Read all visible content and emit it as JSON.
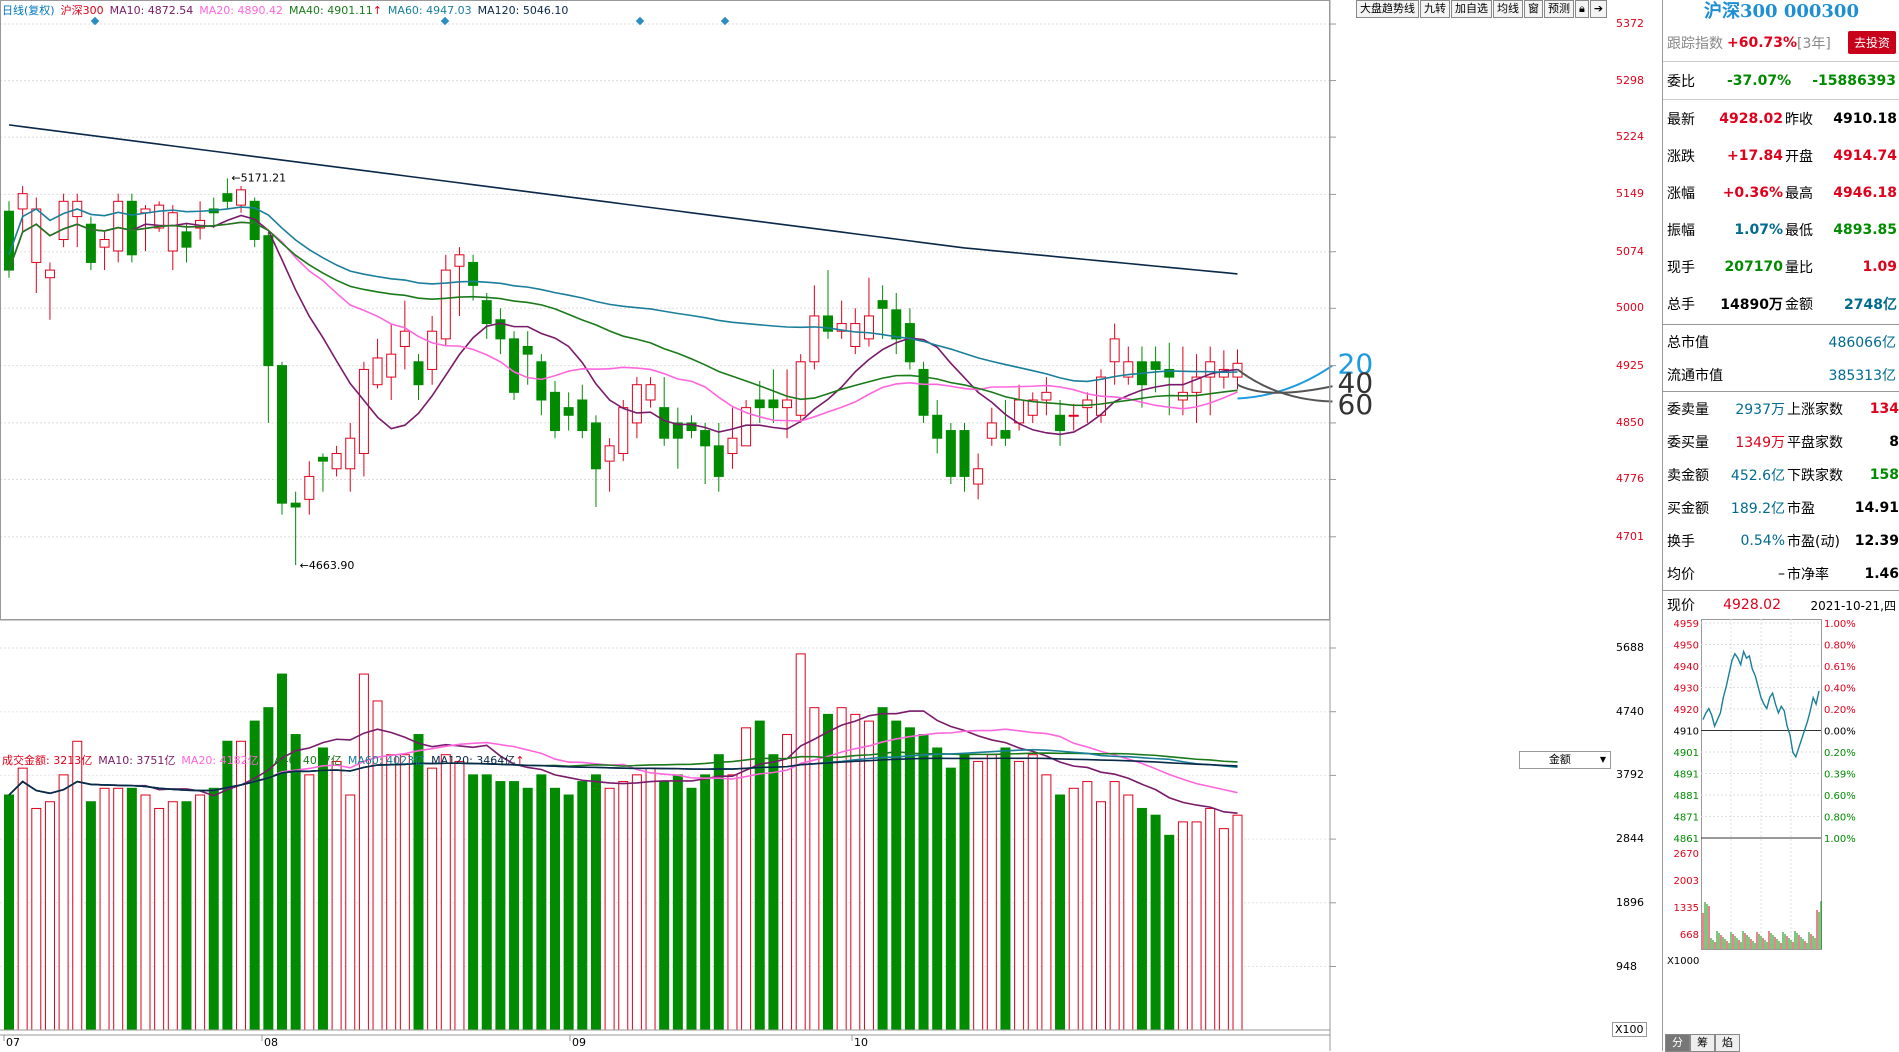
{
  "legend": {
    "period": "日线(复权)",
    "name": "沪深300",
    "ma10": "MA10: 4872.54",
    "ma20": "MA20: 4890.42",
    "ma40": "MA40: 4901.11",
    "ma60": "MA60: 4947.03",
    "ma120": "MA120: 5046.10"
  },
  "toolbar": {
    "trend": "大盘趋势线",
    "nine": "九转",
    "add_watch": "加自选",
    "avg_line": "均线",
    "window": "窗",
    "forecast": "预测",
    "lock_icon": "lock-icon",
    "exit_icon": "exit-icon"
  },
  "price_axis": [
    "5372",
    "5298",
    "5224",
    "5149",
    "5074",
    "5000",
    "4925",
    "4850",
    "4776",
    "4701"
  ],
  "date_axis": [
    "07",
    "08",
    "09",
    "10"
  ],
  "annotations": {
    "high": "5171.21",
    "low": "4663.90"
  },
  "ma_tags": [
    "20",
    "40",
    "60"
  ],
  "vol_legend": {
    "amount": "成交金额: 3213亿",
    "ma10": "MA10: 3751亿",
    "ma20": "MA20: 4182亿",
    "ma40": "MA40: 4077亿",
    "ma60": "MA60: 4023亿",
    "ma120": "MA120: 3464亿"
  },
  "amount_select": "金额",
  "vol_axis": [
    "5688",
    "4740",
    "3792",
    "2844",
    "1896",
    "948"
  ],
  "vol_unit": "X100",
  "side": {
    "title": "沪深300 000300",
    "track_label": "跟踪指数",
    "track_value": "+60.73%",
    "track_period": "[3年]",
    "invest_btn": "去投资",
    "wb_label": "委比",
    "wb_pct": "-37.07%",
    "wb_val": "-15886393",
    "quotes": [
      {
        "l1": "最新",
        "v1": "4928.02",
        "l2": "昨收",
        "v2": "4910.18"
      },
      {
        "l1": "涨跌",
        "v1": "+17.84",
        "l2": "开盘",
        "v2": "4914.74"
      },
      {
        "l1": "涨幅",
        "v1": "+0.36%",
        "l2": "最高",
        "v2": "4946.18"
      },
      {
        "l1": "振幅",
        "v1": "1.07%",
        "l2": "最低",
        "v2": "4893.85"
      },
      {
        "l1": "现手",
        "v1": "207170",
        "l2": "量比",
        "v2": "1.09"
      },
      {
        "l1": "总手",
        "v1": "14890万",
        "l2": "金额",
        "v2": "2748亿"
      }
    ],
    "mktcap_label": "总市值",
    "mktcap_val": "486066亿",
    "float_label": "流通市值",
    "float_val": "385313亿",
    "market": [
      {
        "l1": "委卖量",
        "v1": "2937万",
        "l2": "上涨家数",
        "v2": "134"
      },
      {
        "l1": "委买量",
        "v1": "1349万",
        "l2": "平盘家数",
        "v2": "8"
      },
      {
        "l1": "卖金额",
        "v1": "452.6亿",
        "l2": "下跌家数",
        "v2": "158"
      },
      {
        "l1": "买金额",
        "v1": "189.2亿",
        "l2": "市盈",
        "v2": "14.91"
      },
      {
        "l1": "换手",
        "v1": "0.54%",
        "l2": "市盈(动)",
        "v2": "12.39"
      },
      {
        "l1": "均价",
        "v1": "–",
        "l2": "市净率",
        "v2": "1.46"
      }
    ],
    "now_label": "现价",
    "now_val": "4928.02",
    "date": "2021-10-21,四",
    "mini_left": [
      "4959",
      "4950",
      "4940",
      "4930",
      "4920",
      "4910",
      "4901",
      "4891",
      "4881",
      "4871",
      "4861"
    ],
    "mini_right": [
      "1.00%",
      "0.80%",
      "0.61%",
      "0.40%",
      "0.20%",
      "0.00%",
      "0.20%",
      "0.39%",
      "0.60%",
      "0.80%",
      "1.00%"
    ],
    "mini_vol": [
      "2670",
      "2003",
      "1335",
      "668"
    ],
    "mini_unit": "X1000",
    "tabs": [
      "分",
      "筹",
      "焰"
    ]
  },
  "colors": {
    "up": "#e0001b",
    "down": "#008b00",
    "ma10": "#7a1a6a",
    "ma20": "#ff66dd",
    "ma40": "#1a7a1a",
    "ma60": "#1a7f9a",
    "ma120": "#0a2848",
    "tag20": "#1e9be0"
  },
  "chart_data": {
    "type": "candlestick",
    "ylim": [
      4663,
      5372
    ],
    "candles": [
      [
        5127,
        5050,
        5140,
        5040
      ],
      [
        5130,
        5150,
        5160,
        5100
      ],
      [
        5060,
        5130,
        5145,
        5020
      ],
      [
        5040,
        5050,
        5060,
        4985
      ],
      [
        5090,
        5140,
        5150,
        5080
      ],
      [
        5120,
        5140,
        5150,
        5080
      ],
      [
        5110,
        5060,
        5120,
        5050
      ],
      [
        5080,
        5090,
        5100,
        5050
      ],
      [
        5075,
        5140,
        5150,
        5060
      ],
      [
        5140,
        5070,
        5150,
        5060
      ],
      [
        5125,
        5130,
        5135,
        5075
      ],
      [
        5105,
        5135,
        5140,
        5100
      ],
      [
        5075,
        5125,
        5135,
        5050
      ],
      [
        5100,
        5080,
        5110,
        5060
      ],
      [
        5105,
        5115,
        5140,
        5090
      ],
      [
        5130,
        5125,
        5145,
        5105
      ],
      [
        5150,
        5140,
        5170,
        5130
      ],
      [
        5135,
        5155,
        5160,
        5125
      ],
      [
        5140,
        5090,
        5145,
        5080
      ],
      [
        5095,
        4925,
        5100,
        4850
      ],
      [
        4925,
        4745,
        4930,
        4730
      ],
      [
        4745,
        4740,
        4760,
        4664
      ],
      [
        4750,
        4780,
        4800,
        4730
      ],
      [
        4805,
        4800,
        4810,
        4760
      ],
      [
        4790,
        4810,
        4820,
        4780
      ],
      [
        4790,
        4830,
        4850,
        4760
      ],
      [
        4810,
        4920,
        4930,
        4780
      ],
      [
        4900,
        4935,
        4960,
        4895
      ],
      [
        4910,
        4940,
        4980,
        4880
      ],
      [
        4950,
        4970,
        5010,
        4920
      ],
      [
        4930,
        4900,
        4940,
        4880
      ],
      [
        4920,
        4970,
        4990,
        4900
      ],
      [
        4960,
        5050,
        5070,
        4950
      ],
      [
        5055,
        5070,
        5080,
        4990
      ],
      [
        5060,
        5030,
        5070,
        5010
      ],
      [
        5010,
        4980,
        5020,
        4960
      ],
      [
        4985,
        4960,
        5000,
        4940
      ],
      [
        4960,
        4890,
        4970,
        4880
      ],
      [
        4950,
        4940,
        4970,
        4900
      ],
      [
        4930,
        4880,
        4940,
        4860
      ],
      [
        4890,
        4840,
        4905,
        4830
      ],
      [
        4870,
        4860,
        4890,
        4840
      ],
      [
        4880,
        4840,
        4900,
        4830
      ],
      [
        4850,
        4790,
        4860,
        4740
      ],
      [
        4800,
        4820,
        4830,
        4760
      ],
      [
        4810,
        4870,
        4880,
        4800
      ],
      [
        4850,
        4900,
        4910,
        4830
      ],
      [
        4880,
        4900,
        4910,
        4870
      ],
      [
        4870,
        4830,
        4910,
        4820
      ],
      [
        4850,
        4830,
        4870,
        4790
      ],
      [
        4850,
        4840,
        4860,
        4830
      ],
      [
        4840,
        4820,
        4850,
        4770
      ],
      [
        4820,
        4780,
        4850,
        4760
      ],
      [
        4810,
        4830,
        4870,
        4790
      ],
      [
        4820,
        4870,
        4880,
        4820
      ],
      [
        4880,
        4870,
        4905,
        4850
      ],
      [
        4880,
        4870,
        4920,
        4850
      ],
      [
        4870,
        4880,
        4920,
        4830
      ],
      [
        4860,
        4930,
        4940,
        4850
      ],
      [
        4930,
        4990,
        5030,
        4920
      ],
      [
        4990,
        4970,
        5050,
        4960
      ],
      [
        4970,
        4980,
        5010,
        4960
      ],
      [
        4950,
        4980,
        5000,
        4940
      ],
      [
        4960,
        4990,
        5040,
        4950
      ],
      [
        5010,
        5000,
        5030,
        4960
      ],
      [
        4998,
        4960,
        5020,
        4940
      ],
      [
        4980,
        4930,
        5000,
        4920
      ],
      [
        4920,
        4860,
        4930,
        4850
      ],
      [
        4860,
        4830,
        4880,
        4810
      ],
      [
        4840,
        4780,
        4850,
        4770
      ],
      [
        4840,
        4780,
        4850,
        4760
      ],
      [
        4770,
        4790,
        4810,
        4750
      ],
      [
        4830,
        4850,
        4870,
        4820
      ],
      [
        4840,
        4830,
        4880,
        4820
      ],
      [
        4850,
        4880,
        4900,
        4840
      ],
      [
        4860,
        4880,
        4890,
        4850
      ],
      [
        4880,
        4890,
        4910,
        4860
      ],
      [
        4860,
        4840,
        4880,
        4820
      ],
      [
        4860,
        4860,
        4875,
        4840
      ],
      [
        4870,
        4880,
        4890,
        4850
      ],
      [
        4860,
        4910,
        4920,
        4850
      ],
      [
        4930,
        4960,
        4980,
        4900
      ],
      [
        4910,
        4930,
        4950,
        4900
      ],
      [
        4930,
        4900,
        4950,
        4870
      ],
      [
        4930,
        4920,
        4950,
        4890
      ],
      [
        4920,
        4910,
        4955,
        4860
      ],
      [
        4880,
        4890,
        4950,
        4860
      ],
      [
        4890,
        4910,
        4940,
        4850
      ],
      [
        4910,
        4930,
        4950,
        4860
      ],
      [
        4910,
        4920,
        4945,
        4895
      ],
      [
        4910,
        4928,
        4946,
        4894
      ]
    ]
  }
}
